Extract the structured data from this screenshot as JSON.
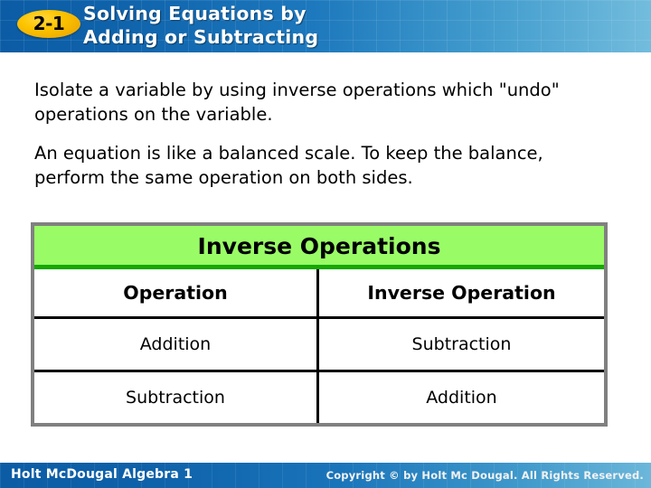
{
  "header": {
    "lesson_badge": "2-1",
    "title_line1": "Solving Equations by",
    "title_line2": "Adding or Subtracting",
    "background_color": "#0b5ca5",
    "badge_color": "#fcc400"
  },
  "body": {
    "paragraph_1": "Isolate a variable by using inverse operations which \"undo\" operations on the variable.",
    "paragraph_2": "An equation is like a balanced scale. To keep the balance, perform the same operation on both sides."
  },
  "table": {
    "title": "Inverse Operations",
    "title_background": "#99fc66",
    "title_rule_color": "#16a800",
    "border_color": "#808080",
    "columns": [
      "Operation",
      "Inverse Operation"
    ],
    "rows": [
      [
        "Addition",
        "Subtraction"
      ],
      [
        "Subtraction",
        "Addition"
      ]
    ]
  },
  "footer": {
    "left_text": "Holt McDougal Algebra 1",
    "copyright": "Copyright © by Holt Mc Dougal. All Rights Reserved."
  }
}
